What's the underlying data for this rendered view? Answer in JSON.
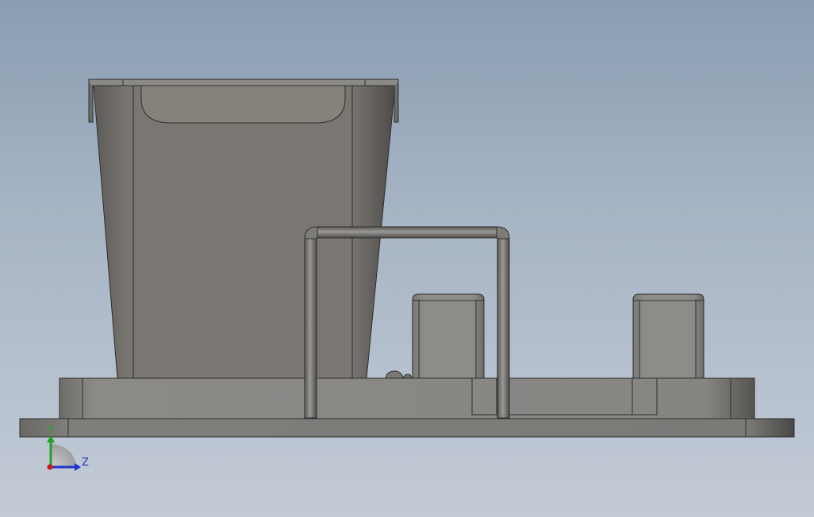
{
  "viewport": {
    "name": "cad-graphics-area",
    "background_top": "#8a9db2",
    "background_bottom": "#c3cbd6"
  },
  "model": {
    "body_color": "#787570",
    "edge_color": "#2e2e2e",
    "highlight_color": "#a8a6a2"
  },
  "triad": {
    "y_label": "Y",
    "z_label": "Z",
    "y_color": "#1fa31f",
    "z_color": "#2233cc",
    "x_color": "#d01818"
  }
}
